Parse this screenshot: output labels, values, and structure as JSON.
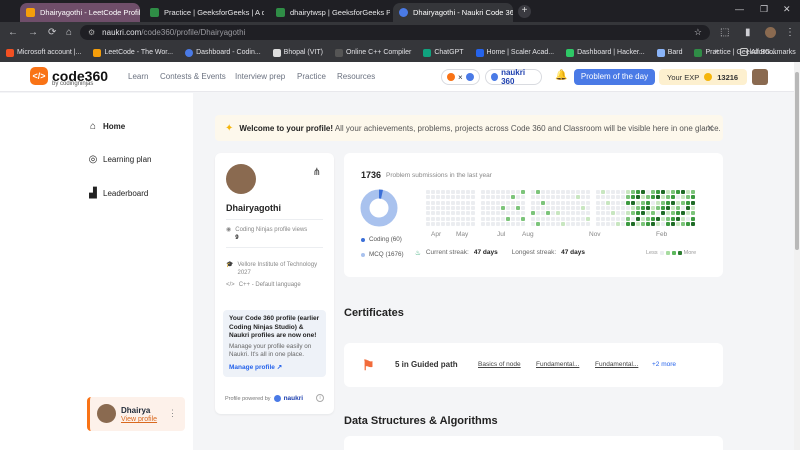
{
  "browser": {
    "tabs": [
      {
        "title": "Dhairyagothi - LeetCode Profile"
      },
      {
        "title": "Practice | GeeksforGeeks | A co"
      },
      {
        "title": "dhairytwsp | GeeksforGeeks Pr"
      },
      {
        "title": "Dhairyagothi - Naukri Code 360"
      }
    ],
    "url_host": "naukri.com",
    "url_path": "/code360/profile/Dhairyagothi",
    "bookmarks": [
      "Microsoft account |...",
      "LeetCode - The Wor...",
      "Dashboard - Codin...",
      "Bhopal (VIT)",
      "Online C++ Compiler",
      "ChatGPT",
      "Home | Scaler Acad...",
      "Dashboard | Hacker...",
      "Bard",
      "Practice | GeeksforG..."
    ],
    "all_bookmarks": "All Bookmarks"
  },
  "header": {
    "logo_text": "code360",
    "logo_sub": "by codingninjas",
    "nav": [
      "Learn",
      "Contests & Events",
      "Interview prep",
      "Practice",
      "Resources"
    ],
    "naukri_pill": "naukri 360",
    "problem_btn": "Problem of the day",
    "exp_label": "Your EXP",
    "exp_value": "13216",
    "colors": {
      "accent": "#4a7ae6",
      "brand": "#f97316"
    }
  },
  "sidebar": {
    "items": [
      {
        "label": "Home",
        "icon": "home-icon"
      },
      {
        "label": "Learning plan",
        "icon": "target-icon"
      },
      {
        "label": "Leaderboard",
        "icon": "leaderboard-icon"
      }
    ],
    "user": {
      "name": "Dhairya",
      "link": "View profile"
    }
  },
  "banner": {
    "title": "Welcome to your profile!",
    "text": "All your achievements, problems, projects across Code 360 and Classroom will be visible here in one glance."
  },
  "profile": {
    "name": "Dhairyagothi",
    "views_label": "Coding Ninjas profile views",
    "views": "9",
    "college": "Vellore Institute of Technology",
    "year": "2027",
    "language": "C++ - Default language",
    "info_title": "Your Code 360 profile (earlier Coding Ninjas Studio) & Naukri profiles are now one!",
    "info_text": "Manage your profile easily on Naukri. It's all in one place.",
    "info_link": "Manage profile",
    "powered": "Profile powered by",
    "powered_brand": "naukri"
  },
  "activity": {
    "count": "1736",
    "count_label": "Problem submissions in the last year",
    "legend": [
      {
        "label": "Coding (60)",
        "color": "#3b6fd8"
      },
      {
        "label": "MCQ (1676)",
        "color": "#a9c2ee"
      }
    ],
    "donut": {
      "coding": 60,
      "mcq": 1676
    },
    "current_label": "Current streak:",
    "current_value": "47 days",
    "longest_label": "Longest streak:",
    "longest_value": "47 days",
    "months": [
      "Apr",
      "May",
      "Jul",
      "Aug",
      "Nov",
      "Feb"
    ],
    "less": "Less",
    "more": "More"
  },
  "certificates": {
    "title": "Certificates",
    "guided": "5 in Guided path",
    "links": [
      "Basics of node",
      "Fundamental...",
      "Fundamental..."
    ],
    "more": "+2 more"
  },
  "dsa_title": "Data Structures & Algorithms"
}
